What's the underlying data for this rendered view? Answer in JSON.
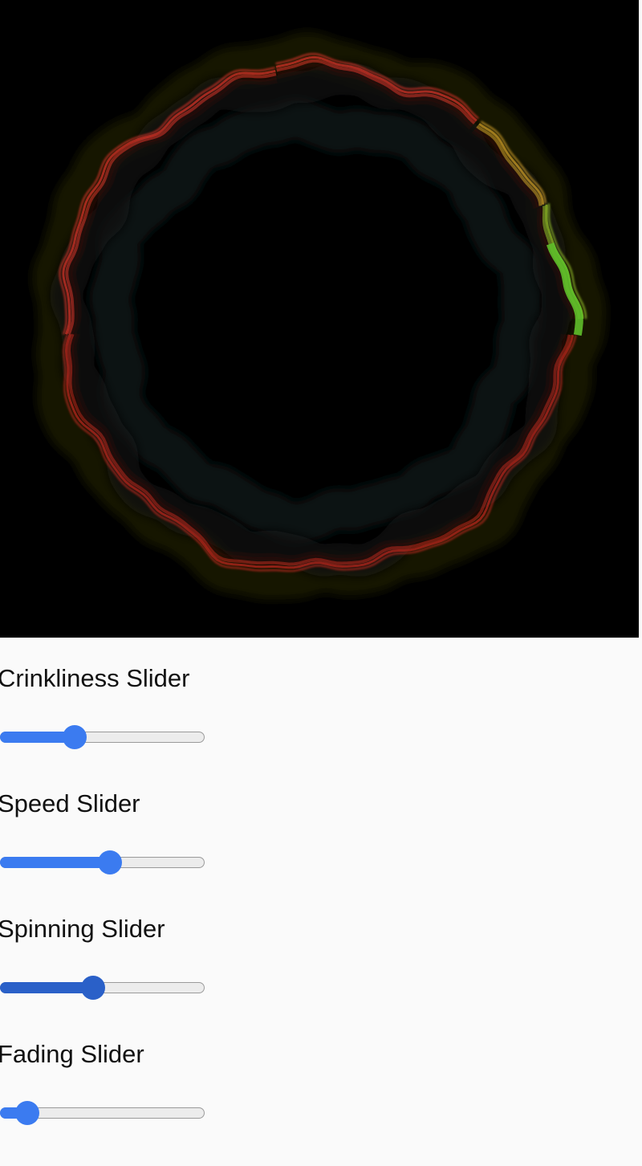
{
  "canvas": {
    "background": "#000000",
    "ring_colors": [
      "#e0352a",
      "#d8a52a",
      "#9cc92a",
      "#5fbf2a",
      "#c3281e"
    ]
  },
  "sliders": [
    {
      "label": "Crinkliness Slider",
      "value": 0.35,
      "active": false
    },
    {
      "label": "Speed Slider",
      "value": 0.54,
      "active": false
    },
    {
      "label": "Spinning Slider",
      "value": 0.45,
      "active": true
    },
    {
      "label": "Fading Slider",
      "value": 0.09,
      "active": false
    }
  ],
  "colors": {
    "accent": "#3b7bf0",
    "accent_active": "#2a60c8",
    "track": "#ececec",
    "page_background": "#fafafa"
  }
}
